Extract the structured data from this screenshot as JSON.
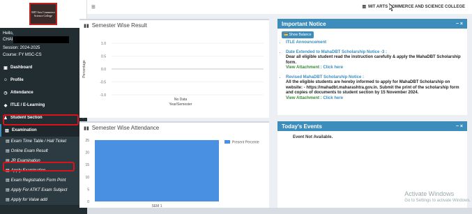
{
  "sidebar": {
    "logo_text": "MIT Arts Commerce Science College",
    "hello_label": "Hello,",
    "user_first": "CHAI",
    "session": "Session: 2024-2025",
    "course": "Course: FY MSC-CS",
    "items": [
      {
        "label": "Dashboard",
        "icon": "dashboard-icon"
      },
      {
        "label": "Profile",
        "icon": "user-icon"
      },
      {
        "label": "Attendance",
        "icon": "clock-icon"
      },
      {
        "label": "ITLE / E-Learning",
        "icon": "graduation-icon"
      },
      {
        "label": "Student Section",
        "icon": "person-icon"
      },
      {
        "label": "Examination",
        "icon": "bank-icon"
      }
    ],
    "sub_items": [
      "Exam Time Table / Hall Ticket",
      "Online Exam Result",
      "JR Examination",
      "Apply Examination",
      "Exam Registration Form Print",
      "Apply For ATKT Exam Subject",
      "Apply for Value add"
    ]
  },
  "topbar": {
    "college": "MIT ARTS COMMERCE AND SCIENCE COLLEGE"
  },
  "result_panel": {
    "title": "Semester Wise Result",
    "chart_data": {
      "type": "line",
      "title": "",
      "xlabel": "Year/Semester",
      "ylabel": "Percentage",
      "yticks": [
        "1.0",
        "0.5",
        "0.0",
        "-0.5",
        "-1.0"
      ],
      "ylim": [
        -1.0,
        1.0
      ],
      "no_data_text": "No Data",
      "series": []
    }
  },
  "attendance_panel": {
    "title": "Semester Wise Attendance",
    "chart_data": {
      "type": "bar",
      "categories": [
        "SEM 1"
      ],
      "series": [
        {
          "name": "Present Percentage",
          "values": [
            25
          ]
        }
      ],
      "yticks": [
        "25",
        "20",
        "15",
        "10",
        "5",
        "0"
      ],
      "ylim": [
        0,
        25
      ],
      "legend_text": "Present Percente"
    }
  },
  "notice_panel": {
    "title": "Important Notice",
    "controls": "−  ×",
    "show_button": "Show Balance",
    "items": [
      {
        "head": "ITLE Announcement",
        "body": "",
        "attach_label": "",
        "attach_link": ""
      },
      {
        "head": "Date Extended to MahaDBT Scholarship Notice -3 :",
        "body": "Dear all eligible student read the instruction carefully & apply the MahaDBT Scholarship form.",
        "attach_label": "View Attachment : ",
        "attach_link": "Click here"
      },
      {
        "head": "Revised MahaDBT Scholarship Notice :",
        "body": "All the eligible students are hereby informed to apply for MahaDBT Scholarship on website: - https://mahadbt.maharashtra.gov.in. Submit the print of the scholarship form and copies of documents to student section by 15 November 2024.",
        "attach_label": "View Attachment : ",
        "attach_link": "Click here"
      }
    ]
  },
  "events_panel": {
    "title": "Today's Events",
    "controls": "−  ×",
    "empty_text": "Event Not Available."
  },
  "watermark": {
    "line1": "Activate Windows",
    "line2": "Go to Settings to activate Windows."
  }
}
